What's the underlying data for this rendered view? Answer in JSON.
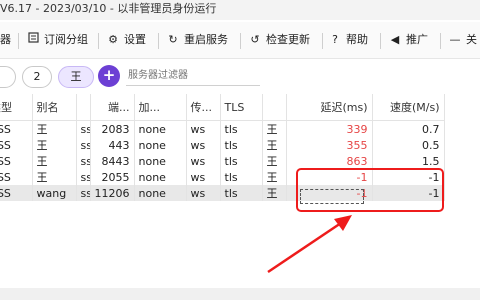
{
  "window": {
    "title": "V6.17 - 2023/03/10 - 以非管理员身份运行"
  },
  "toolbar": {
    "items": [
      {
        "label": "器",
        "icon": "server-icon"
      },
      {
        "label": "订阅分组",
        "icon": "subscription-icon"
      },
      {
        "label": "设置",
        "icon": "gear-icon"
      },
      {
        "label": "重启服务",
        "icon": "restart-icon"
      },
      {
        "label": "检查更新",
        "icon": "update-icon"
      },
      {
        "label": "帮助",
        "icon": "help-icon"
      },
      {
        "label": "推广",
        "icon": "megaphone-icon"
      },
      {
        "label": "关",
        "icon": "minus-icon"
      }
    ]
  },
  "filters": {
    "groups": [
      "",
      "2",
      "王"
    ],
    "add_label": "+",
    "placeholder": "服务器过滤器"
  },
  "table": {
    "columns": [
      "类型",
      "别名",
      "",
      "端...",
      "加...",
      "传...",
      "TLS",
      "",
      "延迟(ms)",
      "速度(M/s)"
    ],
    "rows": [
      {
        "type": "ESS",
        "alias": "王",
        "flag": "ss",
        "port": "2083",
        "enc": "none",
        "net": "ws",
        "tls": "tls",
        "group": "王",
        "latency": "339",
        "speed": "0.7"
      },
      {
        "type": "ESS",
        "alias": "王",
        "flag": "ss",
        "port": "443",
        "enc": "none",
        "net": "ws",
        "tls": "tls",
        "group": "王",
        "latency": "355",
        "speed": "0.5"
      },
      {
        "type": "ESS",
        "alias": "王",
        "flag": "ss",
        "port": "8443",
        "enc": "none",
        "net": "ws",
        "tls": "tls",
        "group": "王",
        "latency": "863",
        "speed": "1.5"
      },
      {
        "type": "ESS",
        "alias": "王",
        "flag": "ss",
        "port": "2055",
        "enc": "none",
        "net": "ws",
        "tls": "tls",
        "group": "王",
        "latency": "-1",
        "speed": "-1"
      },
      {
        "type": "ESS",
        "alias": "wang",
        "flag": "ss",
        "port": "11206",
        "enc": "none",
        "net": "ws",
        "tls": "tls",
        "group": "王",
        "latency": "-1",
        "speed": "-1"
      }
    ]
  },
  "annotation": {
    "color": "#ee1c1c"
  }
}
